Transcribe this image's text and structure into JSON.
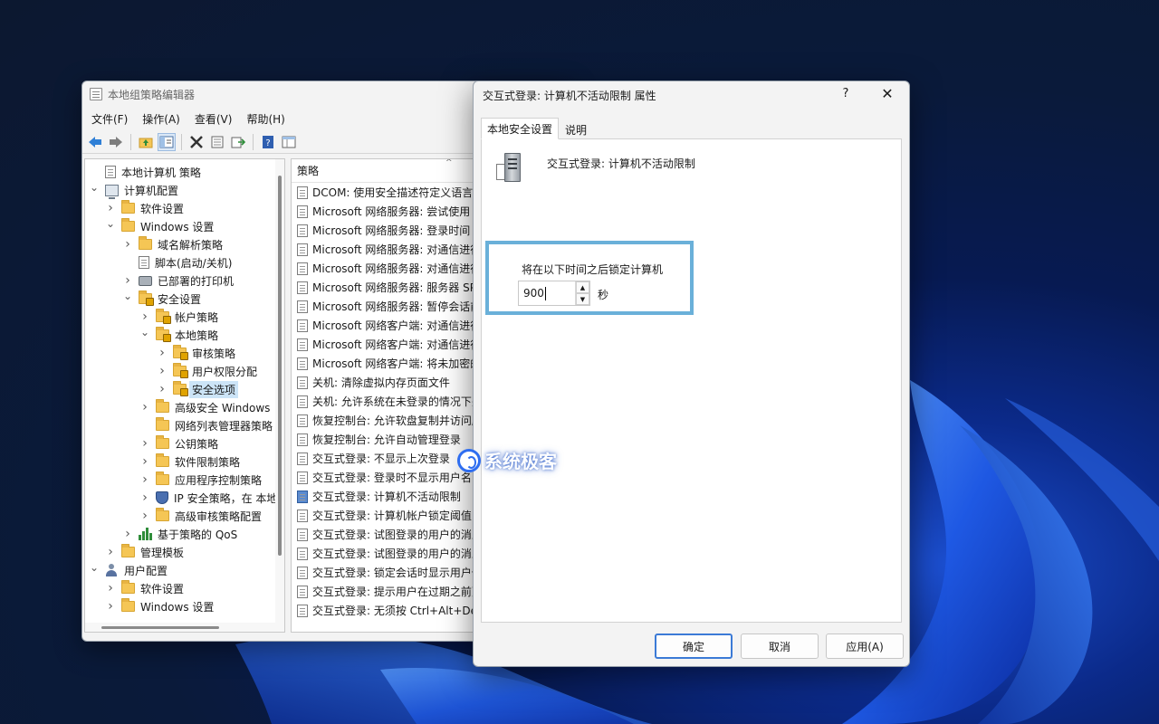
{
  "mmc": {
    "title": "本地组策略编辑器",
    "menu": [
      "文件(F)",
      "操作(A)",
      "查看(V)",
      "帮助(H)"
    ],
    "tree": [
      {
        "label": "本地计算机 策略",
        "chev": "",
        "icon": "doc"
      },
      {
        "label": "计算机配置",
        "chev": "v",
        "icon": "pc"
      },
      {
        "label": "软件设置",
        "chev": ">",
        "icon": "folder"
      },
      {
        "label": "Windows 设置",
        "chev": "v",
        "icon": "folder"
      },
      {
        "label": "域名解析策略",
        "chev": ">",
        "icon": "folder"
      },
      {
        "label": "脚本(启动/关机)",
        "chev": "",
        "icon": "doc"
      },
      {
        "label": "已部署的打印机",
        "chev": ">",
        "icon": "printer"
      },
      {
        "label": "安全设置",
        "chev": "v",
        "icon": "folderlock"
      },
      {
        "label": "帐户策略",
        "chev": ">",
        "icon": "folderlock"
      },
      {
        "label": "本地策略",
        "chev": "v",
        "icon": "folderlock"
      },
      {
        "label": "审核策略",
        "chev": ">",
        "icon": "folderlock"
      },
      {
        "label": "用户权限分配",
        "chev": ">",
        "icon": "folderlock"
      },
      {
        "label": "安全选项",
        "chev": ">",
        "icon": "folderlock"
      },
      {
        "label": "高级安全 Windows",
        "chev": ">",
        "icon": "folder"
      },
      {
        "label": "网络列表管理器策略",
        "chev": "",
        "icon": "folder"
      },
      {
        "label": "公钥策略",
        "chev": ">",
        "icon": "folder"
      },
      {
        "label": "软件限制策略",
        "chev": ">",
        "icon": "folder"
      },
      {
        "label": "应用程序控制策略",
        "chev": ">",
        "icon": "folder"
      },
      {
        "label": "IP 安全策略，在 本地",
        "chev": ">",
        "icon": "shield"
      },
      {
        "label": "高级审核策略配置",
        "chev": ">",
        "icon": "folder"
      },
      {
        "label": "基于策略的 QoS",
        "chev": ">",
        "icon": "bars"
      },
      {
        "label": "管理模板",
        "chev": ">",
        "icon": "folder"
      },
      {
        "label": "用户配置",
        "chev": "v",
        "icon": "user"
      },
      {
        "label": "软件设置",
        "chev": ">",
        "icon": "folder"
      },
      {
        "label": "Windows 设置",
        "chev": ">",
        "icon": "folder"
      }
    ],
    "list_header": "策略",
    "list": [
      "DCOM: 使用安全描述符定义语言",
      "Microsoft 网络服务器: 尝试使用",
      "Microsoft 网络服务器: 登录时间",
      "Microsoft 网络服务器: 对通信进行",
      "Microsoft 网络服务器: 对通信进行",
      "Microsoft 网络服务器: 服务器 SP",
      "Microsoft 网络服务器: 暂停会话前",
      "Microsoft 网络客户端: 对通信进行",
      "Microsoft 网络客户端: 对通信进行",
      "Microsoft 网络客户端: 将未加密的",
      "关机: 清除虚拟内存页面文件",
      "关机: 允许系统在未登录的情况下关",
      "恢复控制台: 允许软盘复制并访问所",
      "恢复控制台: 允许自动管理登录",
      "交互式登录: 不显示上次登录",
      "交互式登录: 登录时不显示用户名",
      "交互式登录: 计算机不活动限制",
      "交互式登录: 计算机帐户锁定阈值",
      "交互式登录: 试图登录的用户的消息",
      "交互式登录: 试图登录的用户的消息",
      "交互式登录: 锁定会话时显示用户信",
      "交互式登录: 提示用户在过期之前更",
      "交互式登录: 无须按 Ctrl+Alt+Del"
    ],
    "highlighted_list_index": 16
  },
  "dialog": {
    "title": "交互式登录: 计算机不活动限制 属性",
    "help": "?",
    "close": "✕",
    "tabs": [
      "本地安全设置",
      "说明"
    ],
    "policy_name": "交互式登录: 计算机不活动限制",
    "lock_label": "将在以下时间之后锁定计算机",
    "value": "900",
    "unit": "秒",
    "buttons": {
      "ok": "确定",
      "cancel": "取消",
      "apply": "应用(A)"
    }
  },
  "watermark": "系统极客",
  "colors": {
    "highlight_border": "#6ab0d9",
    "primary_button": "#3b7ad6",
    "selection": "#cce4f7"
  }
}
